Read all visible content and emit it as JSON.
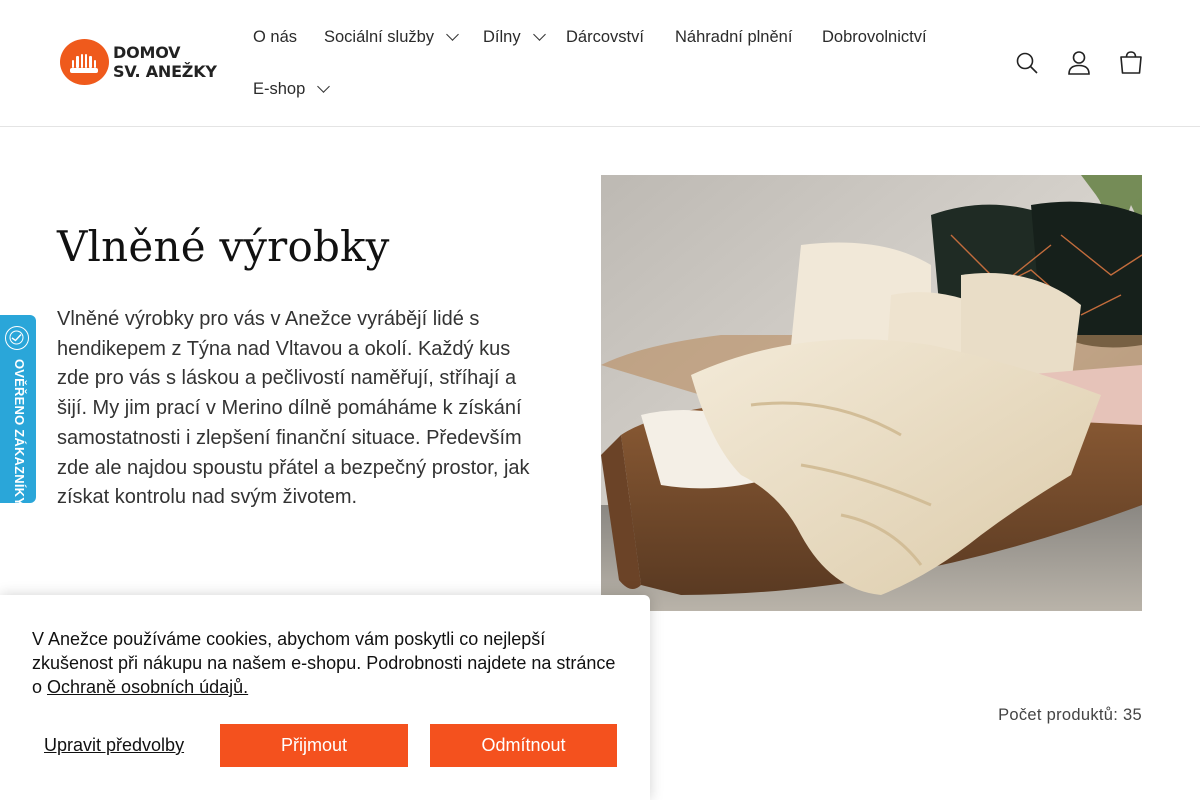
{
  "logo": {
    "line1": "DOMOV",
    "line2": "SV. ANEŽKY",
    "brand_color": "#ef5a1c"
  },
  "nav": {
    "items": [
      {
        "label": "O nás",
        "has_dropdown": false
      },
      {
        "label": "Sociální služby",
        "has_dropdown": true
      },
      {
        "label": "Dílny",
        "has_dropdown": true
      },
      {
        "label": "Dárcovství",
        "has_dropdown": false
      },
      {
        "label": "Náhradní plnění",
        "has_dropdown": false
      },
      {
        "label": "Dobrovolnictví",
        "has_dropdown": false
      },
      {
        "label": "E-shop",
        "has_dropdown": true
      }
    ]
  },
  "header_icons": [
    "search-icon",
    "account-icon",
    "cart-icon"
  ],
  "side_badge": {
    "text": "OVĚŘENO ZÁKAZNÍKY",
    "color": "#2aa6d9"
  },
  "main": {
    "title": "Vlněné výrobky",
    "intro": "Vlněné výrobky pro vás v Anežce vyrábějí lidé s hendikepem z Týna nad Vltavou a okolí. Každý kus zde pro vás s láskou a pečlivostí naměřují, stříhají a šijí. My jim prací v Merino dílně pomáháme k získání samostatnosti i zlepšení finanční situace. Především zde ale najdou spoustu přátel a bezpečný prostor, jak získat kontrolu nad svým životem.",
    "product_count": "Počet produktů: 35"
  },
  "cookie": {
    "text": "V Anežce používáme cookies, abychom vám poskytli co nejlepší zkušenost při nákupu na našem e-shopu. Podrobnosti najdete na stránce o ",
    "link": "Ochraně osobních údajů.",
    "prefs_label": "Upravit předvolby",
    "accept_label": "Přijmout",
    "decline_label": "Odmítnout",
    "button_color": "#f4511e"
  }
}
